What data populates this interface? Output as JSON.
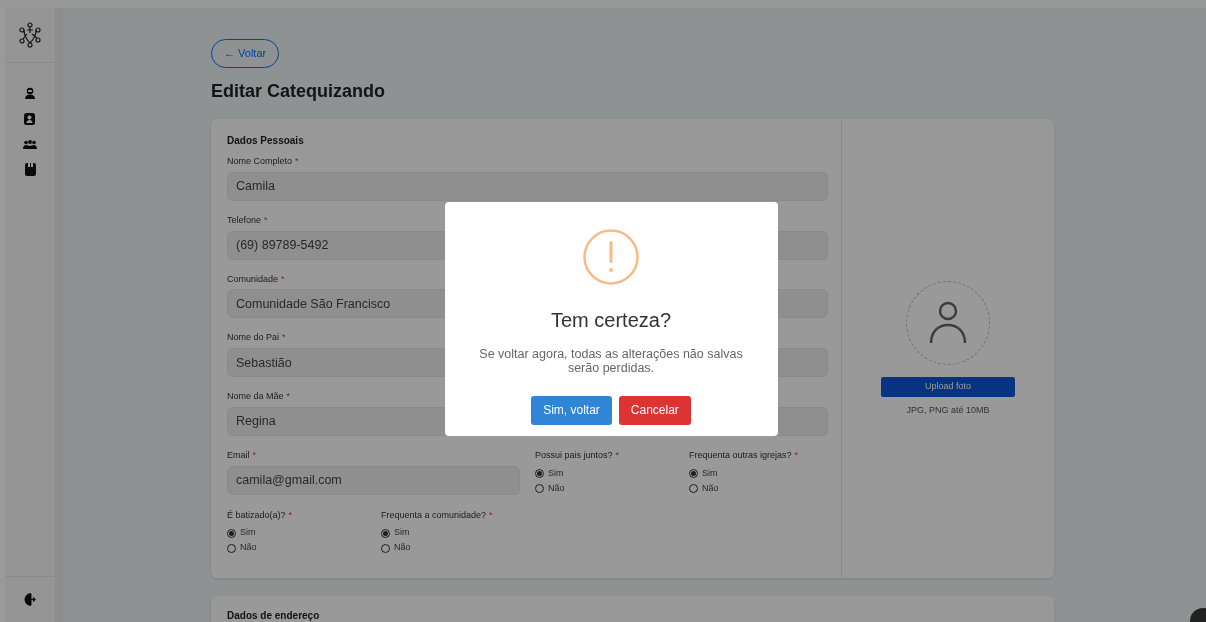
{
  "back_button": "← Voltar",
  "page_title": "Editar Catequizando",
  "personal_section": {
    "title": "Dados Pessoais",
    "items": [
      {
        "kind": "text",
        "label": "Nome Completo",
        "mark": "*",
        "value": "Camila"
      },
      {
        "kind": "text",
        "label": "Telefone",
        "mark": "*",
        "value": "(69) 89789-5492"
      },
      {
        "kind": "text",
        "label": "Comunidade",
        "mark": "*",
        "value": "Comunidade São Francisco"
      },
      {
        "kind": "text",
        "label": "Nome do Pai",
        "mark": "*",
        "value": "Sebastião"
      },
      {
        "kind": "text",
        "label": "Nome da Mãe",
        "mark": "*",
        "value": "Regina"
      },
      {
        "kind": "text",
        "label": "Email",
        "mark": "*",
        "value": "camila@gmail.com"
      },
      {
        "kind": "radio",
        "label": "Possui pais juntos?",
        "mark": "*",
        "options": [
          {
            "label": "Sim",
            "selected": true
          },
          {
            "label": "Não",
            "selected": false
          }
        ]
      },
      {
        "kind": "radio",
        "label": "Frequenta outras igrejas?",
        "mark": "*",
        "options": [
          {
            "label": "Sim",
            "selected": true
          },
          {
            "label": "Não",
            "selected": false
          }
        ]
      },
      {
        "kind": "radio",
        "label": "É batizado(a)?",
        "mark": "*",
        "options": [
          {
            "label": "Sim",
            "selected": true
          },
          {
            "label": "Não",
            "selected": false
          }
        ]
      },
      {
        "kind": "radio",
        "label": "Frequenta a comunidade?",
        "mark": "*",
        "options": [
          {
            "label": "Sim",
            "selected": true
          },
          {
            "label": "Não",
            "selected": false
          }
        ]
      }
    ]
  },
  "photo": {
    "button": "Upload foto",
    "hint": "JPG, PNG até 10MB"
  },
  "address_section": {
    "title": "Dados de endereço"
  },
  "dialog": {
    "title": "Tem certeza?",
    "message": "Se voltar agora, todas as alterações não salvas serão perdidas.",
    "confirm_button": "Sim, voltar",
    "cancel_button": "Cancelar"
  }
}
